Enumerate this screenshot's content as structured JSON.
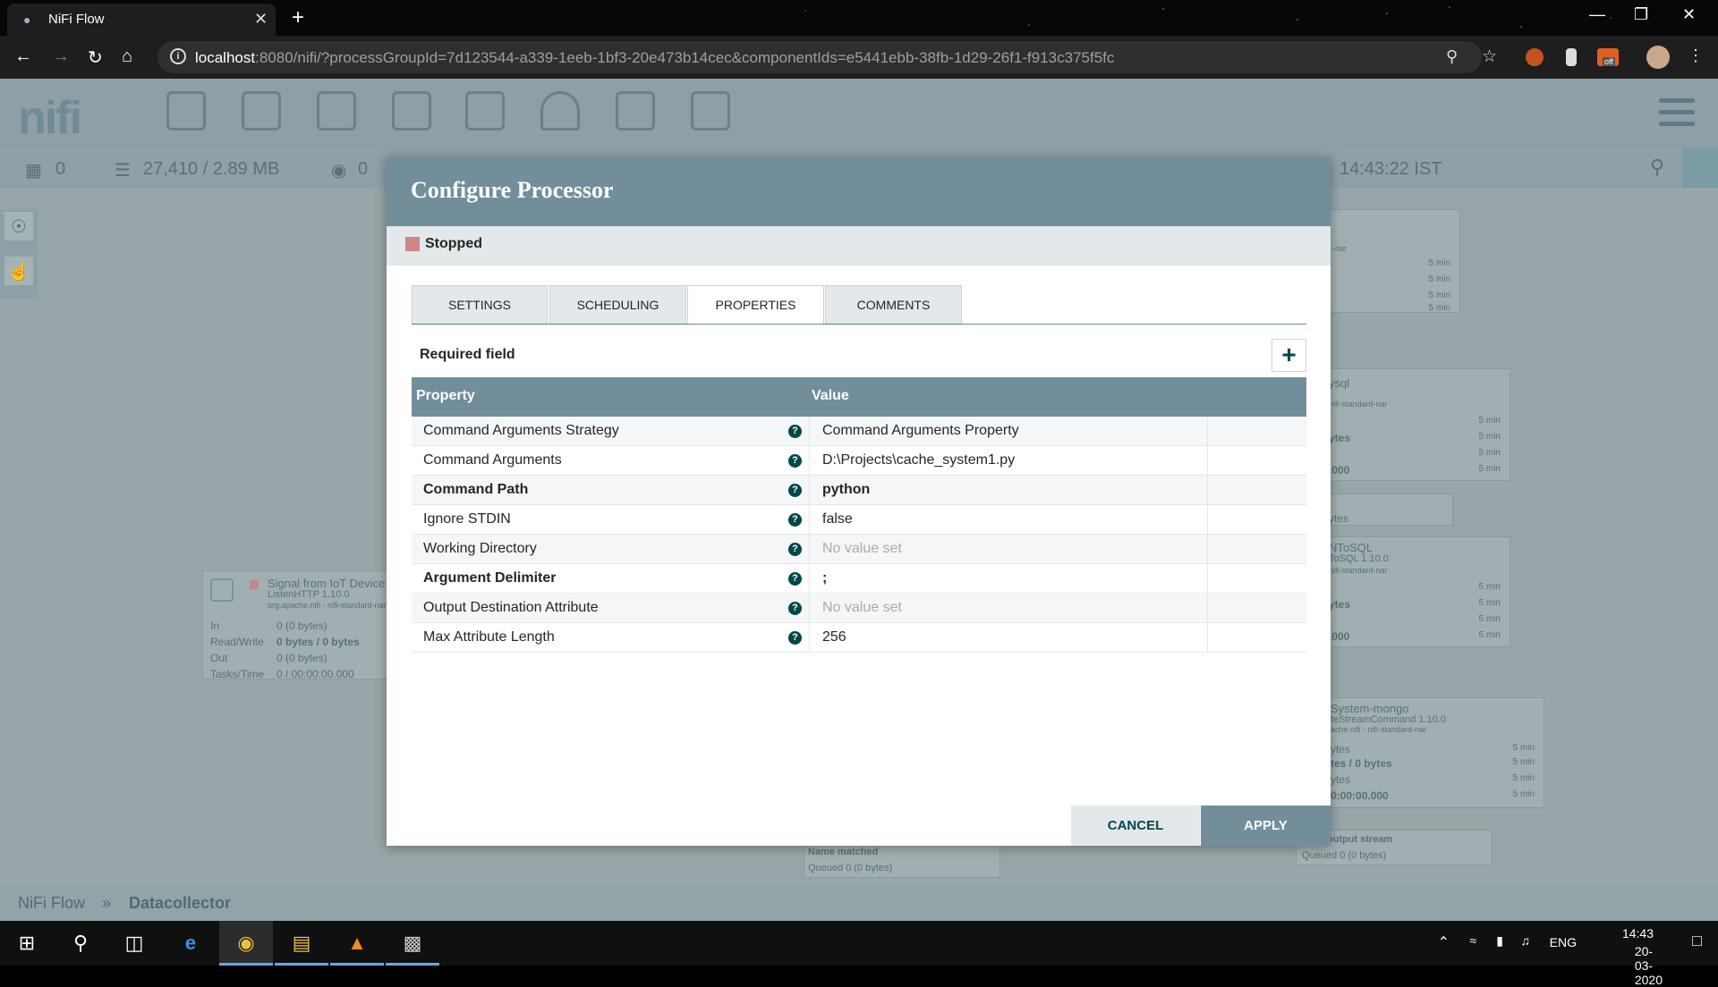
{
  "browser": {
    "tab_title": "NiFi Flow",
    "url_host": "localhost",
    "url_rest": ":8080/nifi/?processGroupId=7d123544-a339-1eeb-1bf3-20e473b14cec&componentIds=e5441ebb-38fb-1d29-26f1-f913c375f5fc",
    "extension_badge": "off"
  },
  "nifi": {
    "logo": "nifi",
    "status": {
      "active_threads": "0",
      "queued": "27,410 / 2.89 MB",
      "remote": "0",
      "time": "14:43:22 IST"
    },
    "background_processor": {
      "name": "Signal from IoT Device",
      "type": "ListenHTTP 1.10.0",
      "bundle": "org.apache.nifi - nifi-standard-nar",
      "rows": [
        {
          "label": "In",
          "value": "0 (0 bytes)"
        },
        {
          "label": "Read/Write",
          "value": "0 bytes / 0 bytes"
        },
        {
          "label": "Out",
          "value": "0 (0 bytes)"
        },
        {
          "label": "Tasks/Time",
          "value": "0 / 00:00:00.000"
        }
      ]
    },
    "ghost_texts": {
      "nar": "-nar",
      "min5": "5 min",
      "mysql": "ysql",
      "mysql_bundle": "nifi-standard-nar",
      "bytes": "ytes",
      "zeros": ".000",
      "tosql": "NToSQL",
      "tosql_ver": "ToSQL 1.10.0",
      "mongo": "System-mongo",
      "mongo_type": "teStreamCommand 1.10.0",
      "mongo_bundle": "ache.nifi - nifi-standard-nar",
      "mongo_rw": "tes / 0 bytes",
      "mongo_time": "0:00:00.000",
      "conn_name": "Name  matched",
      "conn_queued": "Queued  0 (0 bytes)",
      "output_stream": "output stream",
      "output_queued": "Queued  0 (0 bytes)"
    },
    "breadcrumb": {
      "root": "NiFi Flow",
      "separator": "»",
      "current": "Datacollector"
    }
  },
  "dialog": {
    "title": "Configure Processor",
    "state": "Stopped",
    "tabs": [
      "SETTINGS",
      "SCHEDULING",
      "PROPERTIES",
      "COMMENTS"
    ],
    "required_label": "Required field",
    "add_label": "+",
    "columns": {
      "property": "Property",
      "value": "Value"
    },
    "properties": [
      {
        "name": "Command Arguments Strategy",
        "value": "Command Arguments Property",
        "required": false,
        "empty": false
      },
      {
        "name": "Command Arguments",
        "value": "D:\\Projects\\cache_system1.py",
        "required": false,
        "empty": false
      },
      {
        "name": "Command Path",
        "value": "python",
        "required": true,
        "empty": false
      },
      {
        "name": "Ignore STDIN",
        "value": "false",
        "required": false,
        "empty": false
      },
      {
        "name": "Working Directory",
        "value": "No value set",
        "required": false,
        "empty": true
      },
      {
        "name": "Argument Delimiter",
        "value": ";",
        "required": true,
        "empty": false
      },
      {
        "name": "Output Destination Attribute",
        "value": "No value set",
        "required": false,
        "empty": true
      },
      {
        "name": "Max Attribute Length",
        "value": "256",
        "required": false,
        "empty": false
      }
    ],
    "cancel_label": "CANCEL",
    "apply_label": "APPLY"
  },
  "taskbar": {
    "language": "ENG",
    "time": "14:43",
    "date": "20-03-2020"
  },
  "colors": {
    "dialog_header": "#728e9b",
    "stopped": "#d18686",
    "accent": "#004849"
  }
}
